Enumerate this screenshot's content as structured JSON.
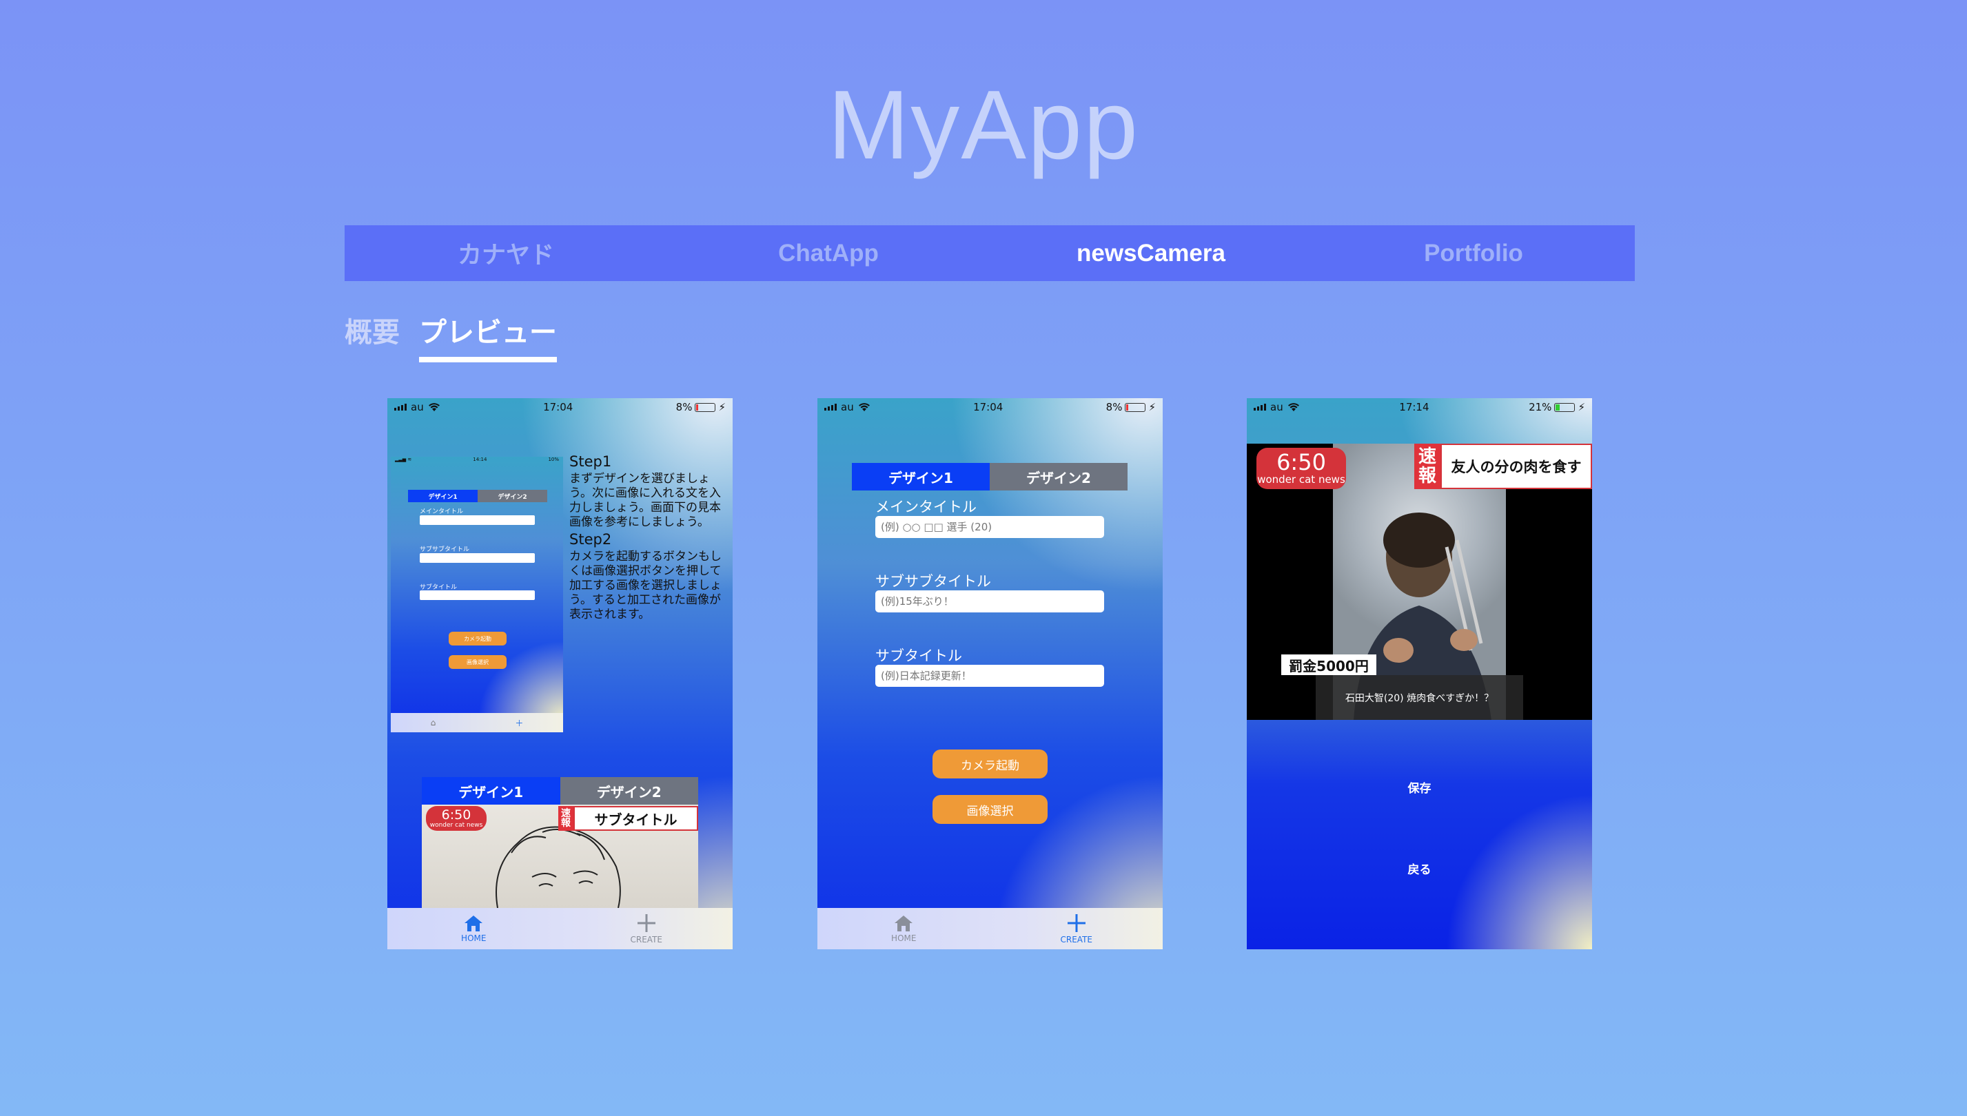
{
  "app": {
    "title": "MyApp"
  },
  "nav": [
    {
      "label": "カナヤド"
    },
    {
      "label": "ChatApp"
    },
    {
      "label": "newsCamera"
    },
    {
      "label": "Portfolio"
    }
  ],
  "subtabs": [
    {
      "label": "概要"
    },
    {
      "label": "プレビュー"
    }
  ],
  "phone1": {
    "status": {
      "carrier": "au",
      "time": "17:04",
      "battery": "8%"
    },
    "mini": {
      "status_time": "14:14",
      "status_battery": "10%",
      "seg": [
        "デザイン1",
        "デザイン2"
      ],
      "labels": [
        "メインタイトル",
        "サブサブタイトル",
        "サブタイトル"
      ],
      "buttons": [
        "カメラ起動",
        "画像選択"
      ]
    },
    "step1_title": "Step1",
    "step1_body": "まずデザインを選びましょう。次に画像に入れる文を入力しましょう。画面下の見本画像を参考にしましょう。",
    "step2_title": "Step2",
    "step2_body": "カメラを起動するボタンもしくは画像選択ボタンを押して加工する画像を選択しましょう。すると加工された画像が表示されます。",
    "sample": {
      "seg": [
        "デザイン1",
        "デザイン2"
      ],
      "time": "6:50",
      "brand": "wonder cat news",
      "sokuhou": "速報",
      "headline": "サブタイトル"
    }
  },
  "phone2": {
    "status": {
      "carrier": "au",
      "time": "17:04",
      "battery": "8%"
    },
    "seg": [
      "デザイン1",
      "デザイン2"
    ],
    "fields": [
      {
        "label": "メインタイトル",
        "placeholder": "(例) ○○ □□ 選手 (20)"
      },
      {
        "label": "サブサブタイトル",
        "placeholder": "(例)15年ぶり！"
      },
      {
        "label": "サブタイトル",
        "placeholder": "(例)日本記録更新！"
      }
    ],
    "buttons": [
      "カメラ起動",
      "画像選択"
    ]
  },
  "phone3": {
    "status": {
      "carrier": "au",
      "time": "17:14",
      "battery": "21%"
    },
    "time": "6:50",
    "brand": "wonder cat news",
    "sokuhou": "速報",
    "headline": "友人の分の肉を食す",
    "fine": "罰金5000円",
    "caption": "石田大智(20) 焼肉食べすぎか！？",
    "save": "保存",
    "back": "戻る"
  },
  "tabbar": {
    "home": "HOME",
    "create": "CREATE"
  },
  "colors": {
    "nav_bg": "#5b6ff7",
    "segment_selected": "#0a3ef5",
    "segment_unselected": "#6e7480",
    "button_orange": "#ef9a37",
    "news_red": "#d4333a",
    "tab_active": "#1f6fe8"
  },
  "icons": [
    "signal-icon",
    "wifi-icon",
    "battery-icon",
    "charging-icon",
    "home-icon",
    "plus-icon"
  ]
}
